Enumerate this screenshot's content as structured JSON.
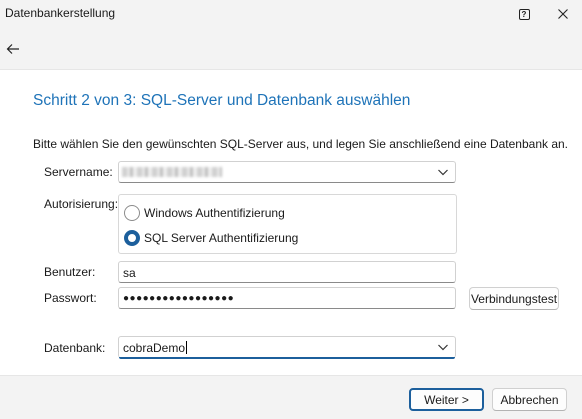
{
  "window": {
    "title": "Datenbankerstellung",
    "help_icon": "help-icon",
    "close_icon": "close-icon"
  },
  "nav": {
    "back_icon": "back-arrow-icon"
  },
  "page": {
    "heading": "Schritt 2 von 3: SQL-Server und Datenbank auswählen",
    "intro": "Bitte wählen Sie den gewünschten SQL-Server aus, und legen Sie anschließend eine Datenbank an."
  },
  "form": {
    "server_label": "Servername:",
    "server_value": "",
    "auth_label": "Autorisierung:",
    "auth_options": [
      {
        "label": "Windows Authentifizierung",
        "selected": false
      },
      {
        "label": "SQL Server Authentifizierung",
        "selected": true
      }
    ],
    "user_label": "Benutzer:",
    "user_value": "sa",
    "password_label": "Passwort:",
    "password_value": "●●●●●●●●●●●●●●●●●",
    "test_button": "Verbindungstest",
    "database_label": "Datenbank:",
    "database_value": "cobraDemo"
  },
  "footer": {
    "next_button": "Weiter >",
    "cancel_button": "Abbrechen"
  },
  "colors": {
    "accent": "#1c5f9c",
    "heading": "#1e73b8",
    "chrome_bg": "#f3f3f3"
  }
}
